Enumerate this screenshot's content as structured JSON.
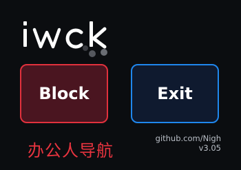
{
  "logo": {
    "text": "iwck",
    "icon": "iwck-logo",
    "color": "#ffffff",
    "accent_dot_color": "#5a5d63"
  },
  "actions": {
    "block_label": "Block",
    "exit_label": "Exit",
    "block_color": "#e2313d",
    "exit_color": "#1f87ee"
  },
  "footer": {
    "repo": "github.com/Nigh",
    "version": "v3.05",
    "app_name_cn": "办公人导航",
    "app_name_color": "#e8343f"
  }
}
